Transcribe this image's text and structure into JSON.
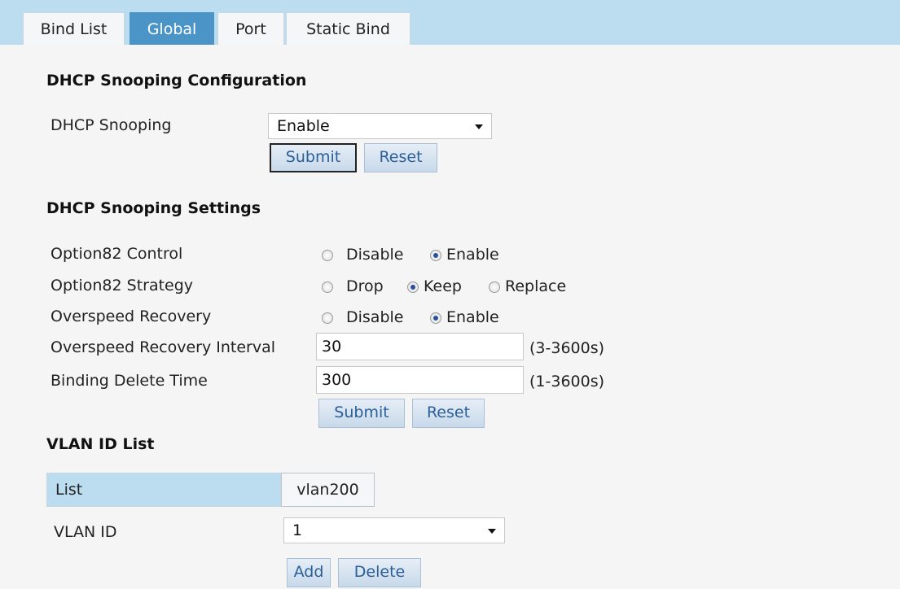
{
  "tabs": [
    "Bind List",
    "Global",
    "Port",
    "Static Bind"
  ],
  "active_tab": "Global",
  "config": {
    "title": "DHCP Snooping Configuration",
    "snooping_label": "DHCP Snooping",
    "snooping_value": "Enable",
    "submit": "Submit",
    "reset": "Reset"
  },
  "settings": {
    "title": "DHCP Snooping Settings",
    "option82_control": {
      "label": "Option82 Control",
      "options": [
        "Disable",
        "Enable"
      ],
      "selected": "Enable"
    },
    "option82_strategy": {
      "label": "Option82 Strategy",
      "options": [
        "Drop",
        "Keep",
        "Replace"
      ],
      "selected": "Keep"
    },
    "overspeed_recovery": {
      "label": "Overspeed Recovery",
      "options": [
        "Disable",
        "Enable"
      ],
      "selected": "Enable"
    },
    "recovery_interval": {
      "label": "Overspeed Recovery Interval",
      "value": "30",
      "hint": "(3-3600s)"
    },
    "binding_delete": {
      "label": "Binding Delete Time",
      "value": "300",
      "hint": "(1-3600s)"
    },
    "submit": "Submit",
    "reset": "Reset"
  },
  "vlan": {
    "title": "VLAN ID List",
    "list_label": "List",
    "list_value": "vlan200",
    "vlan_id_label": "VLAN ID",
    "vlan_id_value": "1",
    "add": "Add",
    "delete": "Delete"
  }
}
